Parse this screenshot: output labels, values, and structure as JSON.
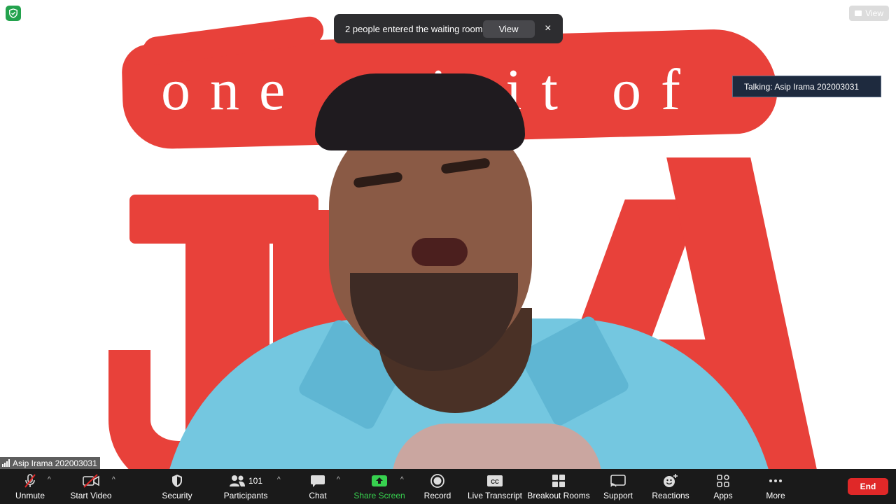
{
  "notification": {
    "message": "2 people entered the waiting room",
    "view_label": "View",
    "close_glyph": "×"
  },
  "top_right": {
    "view_label": "View"
  },
  "talking": {
    "text": "Talking: Asip Irama 202003031"
  },
  "participant": {
    "name": "Asip Irama 202003031"
  },
  "background_text": {
    "line1": "one spirit of"
  },
  "toolbar": {
    "unmute": "Unmute",
    "start_video": "Start Video",
    "security": "Security",
    "participants": "Participants",
    "participants_count": "101",
    "chat": "Chat",
    "share_screen": "Share Screen",
    "record": "Record",
    "live_transcript": "Live Transcript",
    "breakout_rooms": "Breakout Rooms",
    "support": "Support",
    "reactions": "Reactions",
    "apps": "Apps",
    "more": "More",
    "end": "End",
    "caret": "^"
  },
  "colors": {
    "toolbar_bg": "#1a1a1a",
    "share_green": "#37d14f",
    "end_red": "#e02828",
    "shield_green": "#23a24d"
  }
}
